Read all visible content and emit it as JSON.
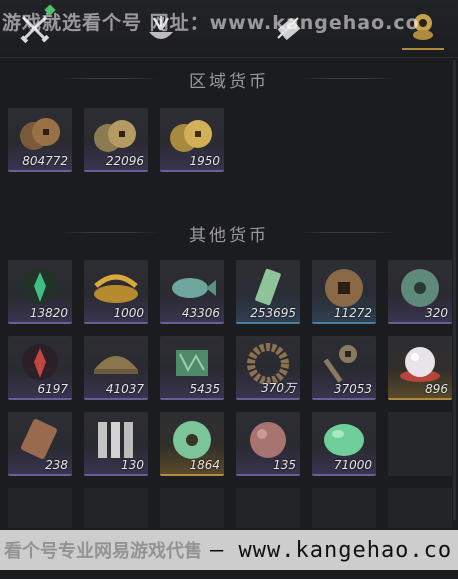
{
  "watermark_top": "游戏就选看个号 网址：www.kangehao.co",
  "tabs": [
    {
      "icon": "crossed-swords-icon",
      "active": false,
      "has_new": true
    },
    {
      "icon": "herb-bowl-icon",
      "active": false,
      "has_new": false
    },
    {
      "icon": "scroll-icon",
      "active": false,
      "has_new": false
    },
    {
      "icon": "coin-stack-icon",
      "active": true,
      "has_new": false
    }
  ],
  "sections": {
    "regional": {
      "title": "区域货币",
      "items": [
        {
          "icon": "copper-coins-icon",
          "quantity": "804772",
          "tier": "purple"
        },
        {
          "icon": "bronze-coins-icon",
          "quantity": "22096",
          "tier": "purple"
        },
        {
          "icon": "gold-coins-icon",
          "quantity": "1950",
          "tier": "purple"
        }
      ]
    },
    "other": {
      "title": "其他货币",
      "items": [
        {
          "icon": "green-flame-token-icon",
          "quantity": "13820",
          "tier": "purple"
        },
        {
          "icon": "golden-grain-icon",
          "quantity": "1000",
          "tier": "purple"
        },
        {
          "icon": "jade-fish-icon",
          "quantity": "43306",
          "tier": "purple"
        },
        {
          "icon": "jade-tablet-icon",
          "quantity": "253695",
          "tier": "blue"
        },
        {
          "icon": "square-hole-coin-icon",
          "quantity": "11272",
          "tier": "blue"
        },
        {
          "icon": "jade-coin-icon",
          "quantity": "320",
          "tier": "purple"
        },
        {
          "icon": "red-flame-token-icon",
          "quantity": "6197",
          "tier": "purple"
        },
        {
          "icon": "bronze-bowl-icon",
          "quantity": "41037",
          "tier": "purple"
        },
        {
          "icon": "jade-map-icon",
          "quantity": "5435",
          "tier": "purple"
        },
        {
          "icon": "coin-string-icon",
          "quantity": "370万",
          "tier": "purple"
        },
        {
          "icon": "ancient-key-coin-icon",
          "quantity": "37053",
          "tier": "purple"
        },
        {
          "icon": "pearl-icon",
          "quantity": "896",
          "tier": "gold"
        },
        {
          "icon": "bronze-plaque-icon",
          "quantity": "238",
          "tier": "purple"
        },
        {
          "icon": "silver-tallies-icon",
          "quantity": "130",
          "tier": "purple"
        },
        {
          "icon": "jade-ring-icon",
          "quantity": "1864",
          "tier": "gold"
        },
        {
          "icon": "red-jade-bead-icon",
          "quantity": "135",
          "tier": "purple"
        },
        {
          "icon": "green-jade-icon",
          "quantity": "71000",
          "tier": "purple"
        }
      ]
    }
  },
  "watermark_bottom": {
    "cn": "看个号专业网易游戏代售",
    "url": "— www.kangehao.co"
  },
  "colors": {
    "background": "#1b1c1f",
    "purple_tier": "#6a5c95",
    "blue_tier": "#4d7ea0",
    "gold_tier": "#b08a3e",
    "active_tab": "#b08a3e"
  }
}
